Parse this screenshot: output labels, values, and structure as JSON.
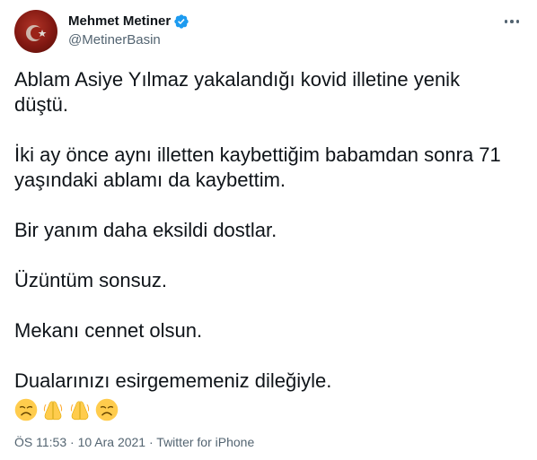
{
  "author": {
    "display_name": "Mehmet Metiner",
    "handle": "@MetinerBasin",
    "verified": true,
    "avatar_icon": "profile-avatar"
  },
  "tweet": {
    "paragraphs": [
      "Ablam Asiye Yılmaz yakalandığı kovid illetine yenik\ndüştü.",
      "İki ay önce aynı illetten kaybettiğim babamdan sonra 71\nyaşındaki ablamı da kaybettim.",
      "Bir yanım daha eksildi dostlar.",
      "Üzüntüm sonsuz.",
      "Mekanı cennet olsun.",
      "Dualarınızı esirgememeniz dileğiyle."
    ],
    "emojis": [
      "disappointed-face",
      "folded-hands",
      "folded-hands",
      "disappointed-face"
    ]
  },
  "meta": {
    "time": "ÖS 11:53",
    "separator": "·",
    "date": "10 Ara 2021",
    "source": "Twitter for iPhone"
  },
  "colors": {
    "verified_blue": "#1d9bf0",
    "secondary_text": "#536471",
    "emoji_yellow": "#ffcc4d"
  }
}
